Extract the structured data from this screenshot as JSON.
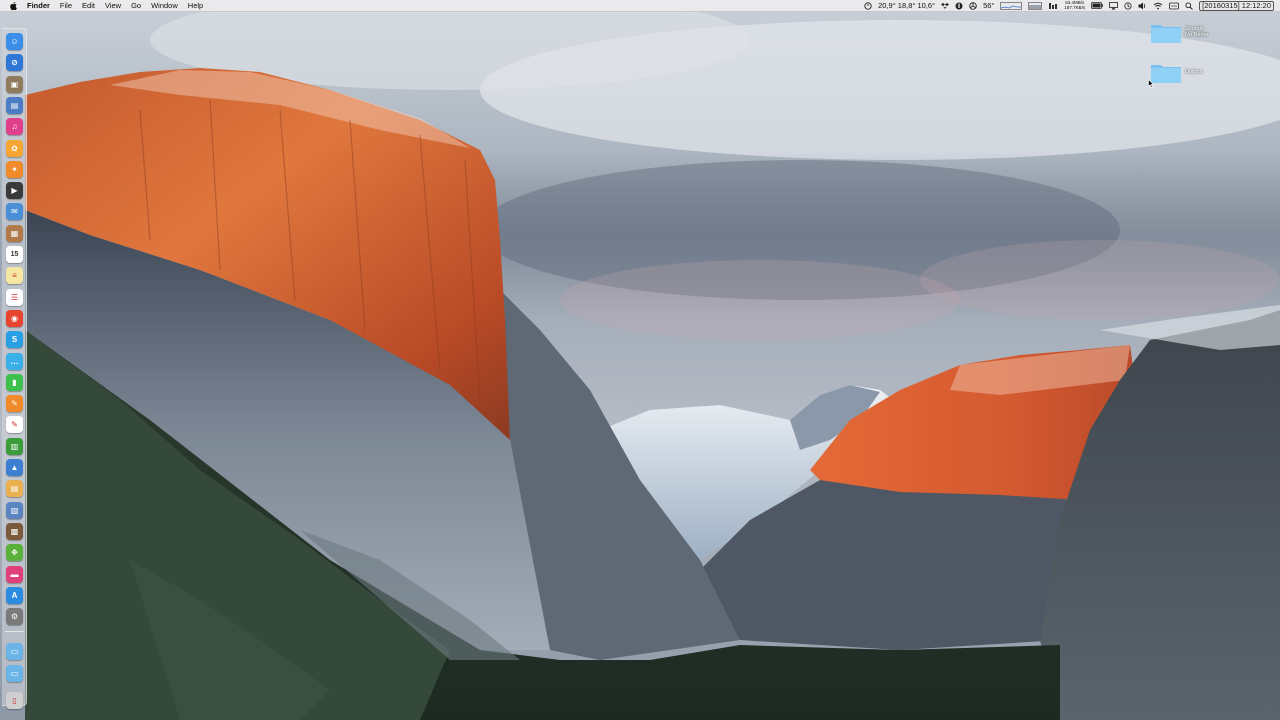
{
  "menubar": {
    "app_name": "Finder",
    "menus": [
      "File",
      "Edit",
      "View",
      "Go",
      "Window",
      "Help"
    ],
    "status": {
      "temps": "20,9° 18,8° 10,6°",
      "battery_temp": "56°",
      "net_up": "63.4MB/s",
      "net_down": "187.7KB/s",
      "clock": "[20160315] 12:12:20"
    }
  },
  "desktop": {
    "icons": [
      {
        "name": "Sounds",
        "sub": "No Name"
      },
      {
        "name": "Dojona",
        "sub": ""
      }
    ]
  },
  "dock": {
    "items": [
      "finder-icon",
      "safari-icon",
      "migration-icon",
      "preview-icon",
      "itunes-icon",
      "photos-icon",
      "ibooks-icon",
      "imovie-icon",
      "mail-icon",
      "contacts-icon",
      "calendar-icon",
      "notes-icon",
      "reminders-icon",
      "chrome-icon",
      "skype-icon",
      "messages-icon",
      "facetime-icon",
      "pages-icon",
      "textedit-icon",
      "numbers-icon",
      "keynote-icon",
      "books-icon",
      "preview2-icon",
      "archive-icon",
      "evernote-icon",
      "screen-icon",
      "appstore-icon",
      "system-prefs-icon",
      "downloads-folder-icon",
      "documents-folder-icon",
      "trash-icon"
    ],
    "colors": [
      "#3b8fe8",
      "#2f77d6",
      "#8f7a5c",
      "#4b7cc4",
      "#e0408b",
      "#f7a533",
      "#f08a2a",
      "#3a3a3a",
      "#4a90d9",
      "#b07a4a",
      "#ffffff",
      "#f5e7a1",
      "#ffffff",
      "#e7432f",
      "#2aa0e4",
      "#3ab0e8",
      "#3ec04c",
      "#f08a2a",
      "#ffffff",
      "#3a9c3a",
      "#3d7fd0",
      "#e9b050",
      "#5a85c0",
      "#7a5a3a",
      "#5ab23a",
      "#e0407a",
      "#2a8be0",
      "#7a7a7a",
      "#6ab4e8",
      "#6ab4e8",
      "#cfcfcf"
    ]
  }
}
